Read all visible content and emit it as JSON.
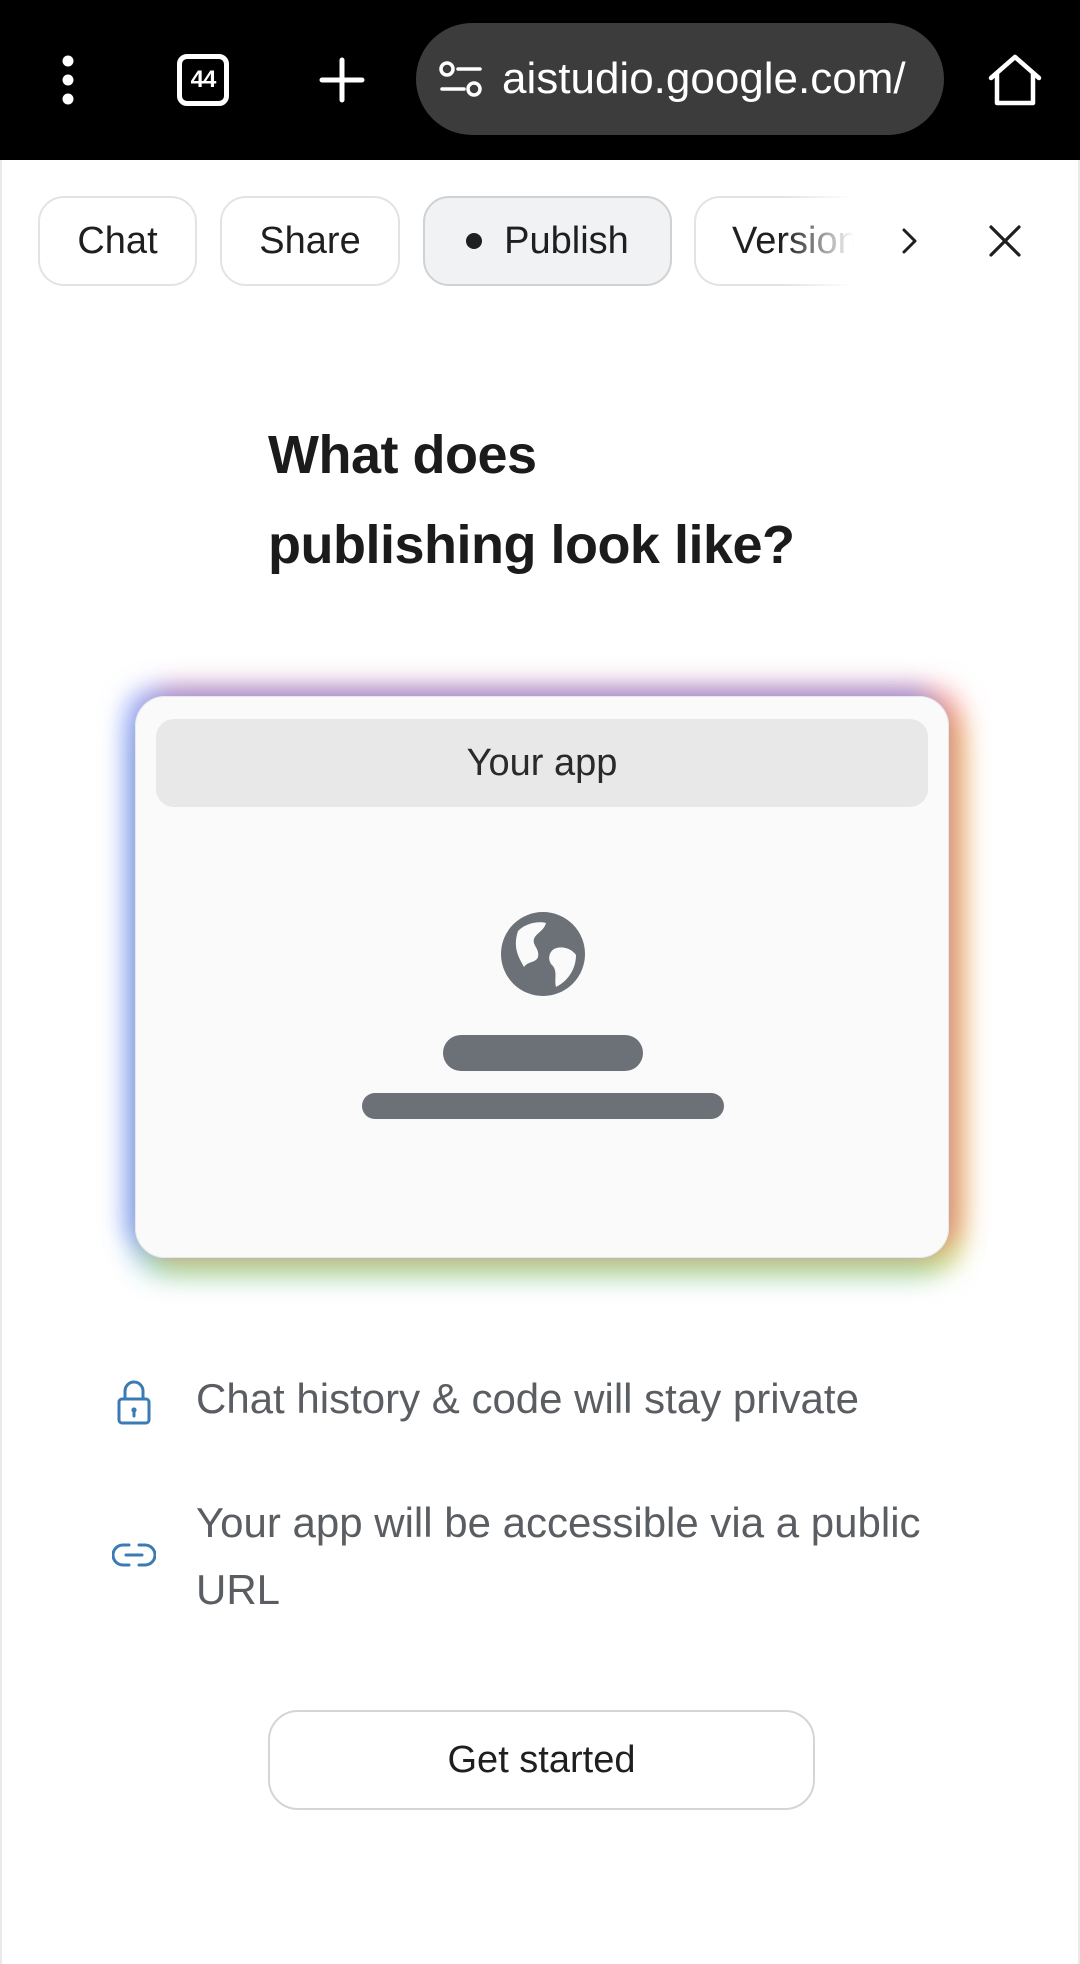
{
  "browser": {
    "tab_count": "44",
    "url": "aistudio.google.com/",
    "icons": [
      "menu-dots-icon",
      "tabs-icon",
      "plus-icon",
      "site-settings-icon",
      "home-icon"
    ]
  },
  "toolbar": {
    "chips": {
      "chat": "Chat",
      "share": "Share",
      "publish": "Publish",
      "versions": "Versions"
    },
    "icons": [
      "chevron-right-icon",
      "close-icon"
    ]
  },
  "main": {
    "heading_line1": "What does",
    "heading_line2": "publishing look like?",
    "illustration": {
      "app_label": "Your app",
      "icon": "globe-icon"
    },
    "info": [
      {
        "icon": "lock-icon",
        "text": "Chat history & code will stay private"
      },
      {
        "icon": "link-icon",
        "text": "Your app will be accessible via a public URL"
      }
    ],
    "cta_label": "Get started"
  },
  "colors": {
    "browser_bar": "#000000",
    "url_pill": "#3c3c3c",
    "info_icon": "#3b7bb5",
    "info_text": "#5a5d61",
    "placeholder_bar": "#6c7077"
  }
}
